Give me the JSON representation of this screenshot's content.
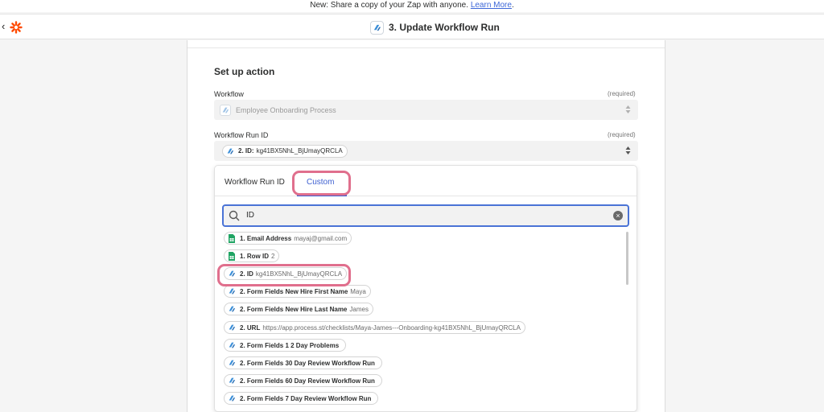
{
  "banner": {
    "text": "New: Share a copy of your Zap with anyone.",
    "link": "Learn More",
    "suffix": "."
  },
  "topbar": {
    "back_icon": "chevron-left-icon",
    "logo": "zapier-logo",
    "step_title": "3. Update Workflow Run"
  },
  "panel": {
    "section_title": "Set up action",
    "workflow": {
      "label": "Workflow",
      "required": "(required)",
      "value": "Employee Onboarding Process"
    },
    "workflow_run_id": {
      "label": "Workflow Run ID",
      "required": "(required)",
      "token_label": "2. ID:",
      "token_value": "kg41BX5NhL_BjUmayQRCLA"
    }
  },
  "dropdown": {
    "tabs": [
      "Workflow Run ID",
      "Custom"
    ],
    "active_tab": "Custom",
    "search_value": "ID",
    "options": [
      {
        "app": "sheets",
        "label": "1. Email Address",
        "value": "mayaj@gmail.com"
      },
      {
        "app": "sheets",
        "label": "1. Row ID",
        "value": "2"
      },
      {
        "app": "process",
        "label": "2. ID",
        "value": "kg41BX5NhL_BjUmayQRCLA"
      },
      {
        "app": "process",
        "label": "2. Form Fields New Hire First Name",
        "value": "Maya"
      },
      {
        "app": "process",
        "label": "2. Form Fields New Hire Last Name",
        "value": "James"
      },
      {
        "app": "process",
        "label": "2. URL",
        "value": "https://app.process.st/checklists/Maya-James---Onboarding-kg41BX5NhL_BjUmayQRCLA"
      },
      {
        "app": "process",
        "label": "2. Form Fields 1 2 Day Problems",
        "value": ""
      },
      {
        "app": "process",
        "label": "2. Form Fields 30 Day Review Workflow Run",
        "value": ""
      },
      {
        "app": "process",
        "label": "2. Form Fields 60 Day Review Workflow Run",
        "value": ""
      },
      {
        "app": "process",
        "label": "2. Form Fields 7 Day Review Workflow Run",
        "value": ""
      }
    ]
  },
  "colors": {
    "accent": "#3d5fd0",
    "highlight": "#e06f8d",
    "sheets_green": "#1fa463",
    "process_blue": "#3b8fd9",
    "zapier_orange": "#ff4a00"
  }
}
